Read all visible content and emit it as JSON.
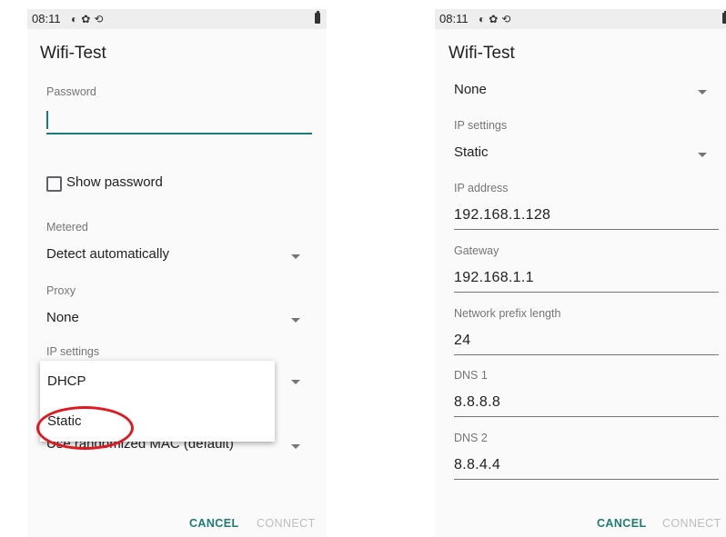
{
  "left": {
    "status": {
      "time": "08:11",
      "icons": [
        "circle-half-icon",
        "gear-icon",
        "sync-icon"
      ],
      "battery": "battery-icon"
    },
    "title": "Wifi-Test",
    "password": {
      "label": "Password",
      "value": ""
    },
    "show_password": {
      "label": "Show password",
      "checked": false
    },
    "metered": {
      "label": "Metered",
      "value": "Detect automatically"
    },
    "proxy": {
      "label": "Proxy",
      "value": "None"
    },
    "ip_settings": {
      "label": "IP settings",
      "options": [
        "DHCP",
        "Static"
      ],
      "highlighted_option": "Static"
    },
    "privacy": {
      "value": "Use randomized MAC (default)"
    },
    "buttons": {
      "cancel": "CANCEL",
      "connect": "CONNECT"
    }
  },
  "right": {
    "status": {
      "time": "08:11",
      "icons": [
        "circle-half-icon",
        "gear-icon",
        "sync-icon"
      ],
      "battery": "battery-icon"
    },
    "title": "Wifi-Test",
    "proxy": {
      "value": "None"
    },
    "ip_settings": {
      "label": "IP settings",
      "value": "Static"
    },
    "ip_address": {
      "label": "IP address",
      "value": "192.168.1.128"
    },
    "gateway": {
      "label": "Gateway",
      "value": "192.168.1.1"
    },
    "prefix": {
      "label": "Network prefix length",
      "value": "24"
    },
    "dns1": {
      "label": "DNS 1",
      "value": "8.8.8.8"
    },
    "dns2": {
      "label": "DNS 2",
      "value": "8.8.4.4"
    },
    "buttons": {
      "cancel": "CANCEL",
      "connect": "CONNECT"
    }
  },
  "colors": {
    "accent": "#1e7b74",
    "highlight_ring": "#e0191e",
    "background": "#fafafa"
  }
}
